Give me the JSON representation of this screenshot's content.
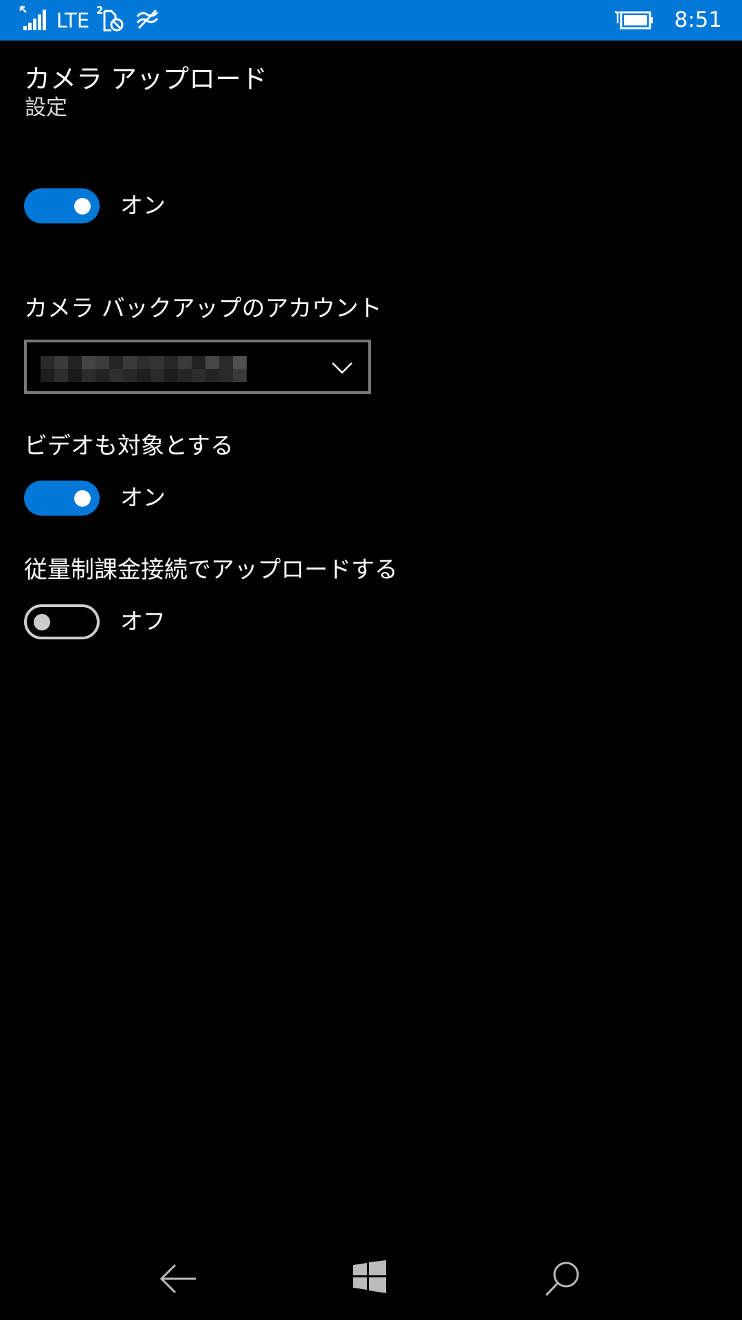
{
  "status_bar": {
    "network": "LTE",
    "sim_number": "2",
    "time": "8:51",
    "icons": [
      "signal-icon",
      "sim-icon",
      "wifi-icon",
      "battery-icon"
    ]
  },
  "header": {
    "app_title": "カメラ アップロード",
    "page_subtitle": "設定"
  },
  "camera_upload": {
    "enabled": true,
    "state_label": "オン"
  },
  "backup_account": {
    "label": "カメラ バックアップのアカウント",
    "value_obscured": true
  },
  "include_videos": {
    "label": "ビデオも対象とする",
    "enabled": true,
    "state_label": "オン"
  },
  "metered_upload": {
    "label": "従量制課金接続でアップロードする",
    "enabled": false,
    "state_label": "オフ"
  },
  "nav_bar": {
    "icons": [
      "back-arrow-icon",
      "windows-logo-icon",
      "search-icon"
    ]
  },
  "colors": {
    "accent": "#0078d7",
    "background": "#000000",
    "text": "#ffffff",
    "toggle_off": "#cccccc"
  }
}
